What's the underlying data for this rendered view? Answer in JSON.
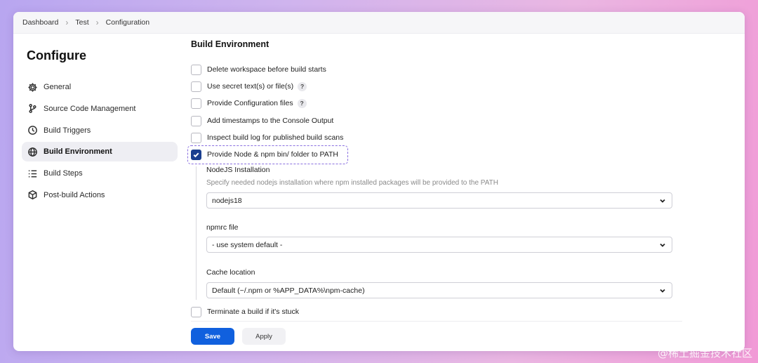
{
  "breadcrumb": [
    "Dashboard",
    "Test",
    "Configuration"
  ],
  "page_title": "Configure",
  "sidebar": {
    "items": [
      {
        "label": "General",
        "icon": "gear-icon"
      },
      {
        "label": "Source Code Management",
        "icon": "branch-icon"
      },
      {
        "label": "Build Triggers",
        "icon": "clock-icon"
      },
      {
        "label": "Build Environment",
        "icon": "globe-icon",
        "active": true
      },
      {
        "label": "Build Steps",
        "icon": "list-icon"
      },
      {
        "label": "Post-build Actions",
        "icon": "cube-icon"
      }
    ]
  },
  "section_title": "Build Environment",
  "options": [
    {
      "label": "Delete workspace before build starts",
      "checked": false
    },
    {
      "label": "Use secret text(s) or file(s)",
      "checked": false,
      "help": "?"
    },
    {
      "label": "Provide Configuration files",
      "checked": false,
      "help": "?"
    },
    {
      "label": "Add timestamps to the Console Output",
      "checked": false
    },
    {
      "label": "Inspect build log for published build scans",
      "checked": false
    },
    {
      "label": "Provide Node & npm bin/ folder to PATH",
      "checked": true
    },
    {
      "label": "Terminate a build if it's stuck",
      "checked": false
    }
  ],
  "node_config": {
    "installation_label": "NodeJS Installation",
    "installation_desc": "Specify needed nodejs installation where npm installed packages will be provided to the PATH",
    "installation_value": "nodejs18",
    "npmrc_label": "npmrc file",
    "npmrc_value": "- use system default -",
    "cache_label": "Cache location",
    "cache_value": "Default (~/.npm or %APP_DATA%\\npm-cache)"
  },
  "buttons": {
    "save": "Save",
    "apply": "Apply"
  },
  "watermark": "@稀土掘金技术社区",
  "colors": {
    "primary": "#1060de",
    "checkbox_checked": "#1a3f8f",
    "highlight": "#8a6fe0"
  }
}
